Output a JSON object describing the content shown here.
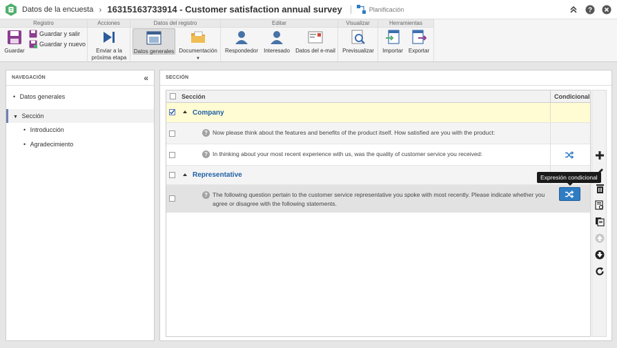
{
  "header": {
    "breadcrumb": "Datos de la encuesta",
    "separator": "›",
    "document_title": "16315163733914 - Customer satisfaction annual survey",
    "planning_label": "Planificación"
  },
  "ribbon": {
    "groups": {
      "registro": "Registro",
      "acciones": "Acciones",
      "datos_registro": "Datos del registro",
      "editar": "Editar",
      "visualizar": "Visualizar",
      "herramientas": "Herramientas"
    },
    "buttons": {
      "guardar": "Guardar",
      "guardar_salir": "Guardar y salir",
      "guardar_nuevo": "Guardar y nuevo",
      "enviar_l1": "Enviar a la",
      "enviar_l2": "próxima etapa",
      "datos_generales": "Datos generales",
      "documentacion": "Documentación",
      "respondedor": "Respondedor",
      "interesado": "Interesado",
      "datos_email": "Datos del e-mail",
      "previsualizar": "Previsualizar",
      "importar": "Importar",
      "exportar": "Exportar"
    }
  },
  "nav": {
    "title": "NAVEGACIÓN",
    "items": {
      "datos_generales": "Datos generales",
      "seccion": "Sección",
      "introduccion": "Introducción",
      "agradecimiento": "Agradecimiento"
    }
  },
  "main": {
    "title": "SECCIÓN",
    "columns": {
      "section": "Sección",
      "conditional": "Condicional"
    },
    "rows": {
      "company": "Company",
      "q1": "Now please think about the features and benefits of the product itself. How satisfied are you with the product:",
      "q2": "In thinking about your most recent experience with us, was the quality of customer service you received:",
      "representative": "Representative",
      "q3_l1": "The following question pertain to the customer service representative you spoke with most recently. Please indicate whether you",
      "q3_l2": "agree or disagree with the following statements."
    },
    "tooltip": "Expresión condicional"
  },
  "colors": {
    "accent_blue": "#1f5fa5",
    "highlight_row": "#fffbd3",
    "tooltip_bg": "#1a1a1a",
    "nav_selected_border": "#6f7fb4"
  }
}
